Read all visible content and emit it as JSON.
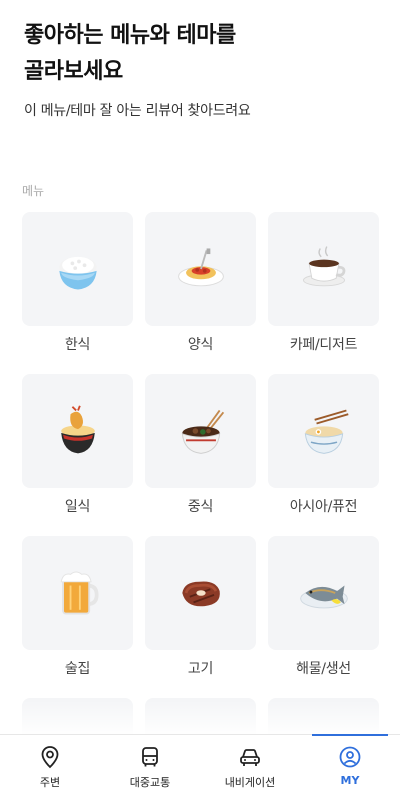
{
  "header": {
    "title_line1": "좋아하는 메뉴와 테마를",
    "title_line2": "골라보세요",
    "subtitle": "이 메뉴/테마 잘 아는 리뷰어 찾아드려요"
  },
  "section": {
    "label": "메뉴"
  },
  "menu_items": [
    {
      "label": "한식",
      "icon": "rice-bowl-icon"
    },
    {
      "label": "양식",
      "icon": "spaghetti-icon"
    },
    {
      "label": "카페/디저트",
      "icon": "coffee-cup-icon"
    },
    {
      "label": "일식",
      "icon": "tempura-bowl-icon"
    },
    {
      "label": "중식",
      "icon": "noodle-bowl-icon"
    },
    {
      "label": "아시아/퓨전",
      "icon": "ramen-bowl-icon"
    },
    {
      "label": "술집",
      "icon": "beer-mug-icon"
    },
    {
      "label": "고기",
      "icon": "steak-icon"
    },
    {
      "label": "해물/생선",
      "icon": "fish-plate-icon"
    }
  ],
  "bottom_nav": [
    {
      "label": "주변",
      "icon": "location-pin-icon",
      "active": false
    },
    {
      "label": "대중교통",
      "icon": "bus-icon",
      "active": false
    },
    {
      "label": "내비게이션",
      "icon": "car-icon",
      "active": false
    },
    {
      "label": "MY",
      "icon": "profile-icon",
      "active": true
    }
  ],
  "colors": {
    "accent": "#2f6fdc",
    "tile_bg": "#f4f5f7",
    "section_label": "#a9a9a9"
  }
}
